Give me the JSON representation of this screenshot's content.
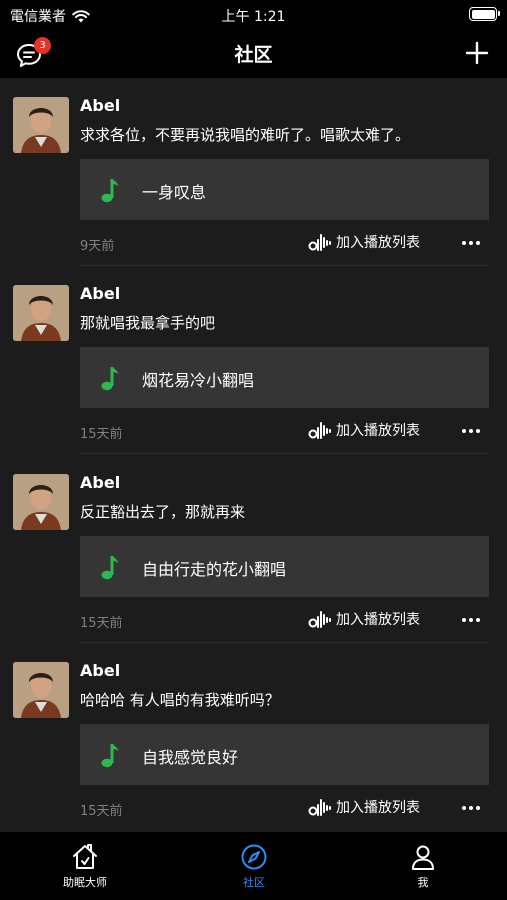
{
  "status_bar": {
    "carrier": "電信業者",
    "time": "上午 1:21"
  },
  "nav": {
    "title": "社区",
    "message_badge": "3"
  },
  "colors": {
    "accent_green": "#2eb84e",
    "badge_red": "#e6332a",
    "active_tab_blue": "#2d8cf0"
  },
  "posts": [
    {
      "author": "Abel",
      "text": "求求各位，不要再说我唱的难听了。唱歌太难了。",
      "song": "一身叹息",
      "time": "9天前",
      "playlist_label": "加入播放列表"
    },
    {
      "author": "Abel",
      "text": "那就唱我最拿手的吧",
      "song": "烟花易冷小翻唱",
      "time": "15天前",
      "playlist_label": "加入播放列表"
    },
    {
      "author": "Abel",
      "text": "反正豁出去了，那就再来",
      "song": "自由行走的花小翻唱",
      "time": "15天前",
      "playlist_label": "加入播放列表"
    },
    {
      "author": "Abel",
      "text": "哈哈哈 有人唱的有我难听吗？",
      "song": "自我感觉良好",
      "time": "15天前",
      "playlist_label": "加入播放列表"
    }
  ],
  "tabs": [
    {
      "label": "助眠大师",
      "icon": "home-icon",
      "active": false
    },
    {
      "label": "社区",
      "icon": "compass-icon",
      "active": true
    },
    {
      "label": "我",
      "icon": "profile-icon",
      "active": false
    }
  ]
}
